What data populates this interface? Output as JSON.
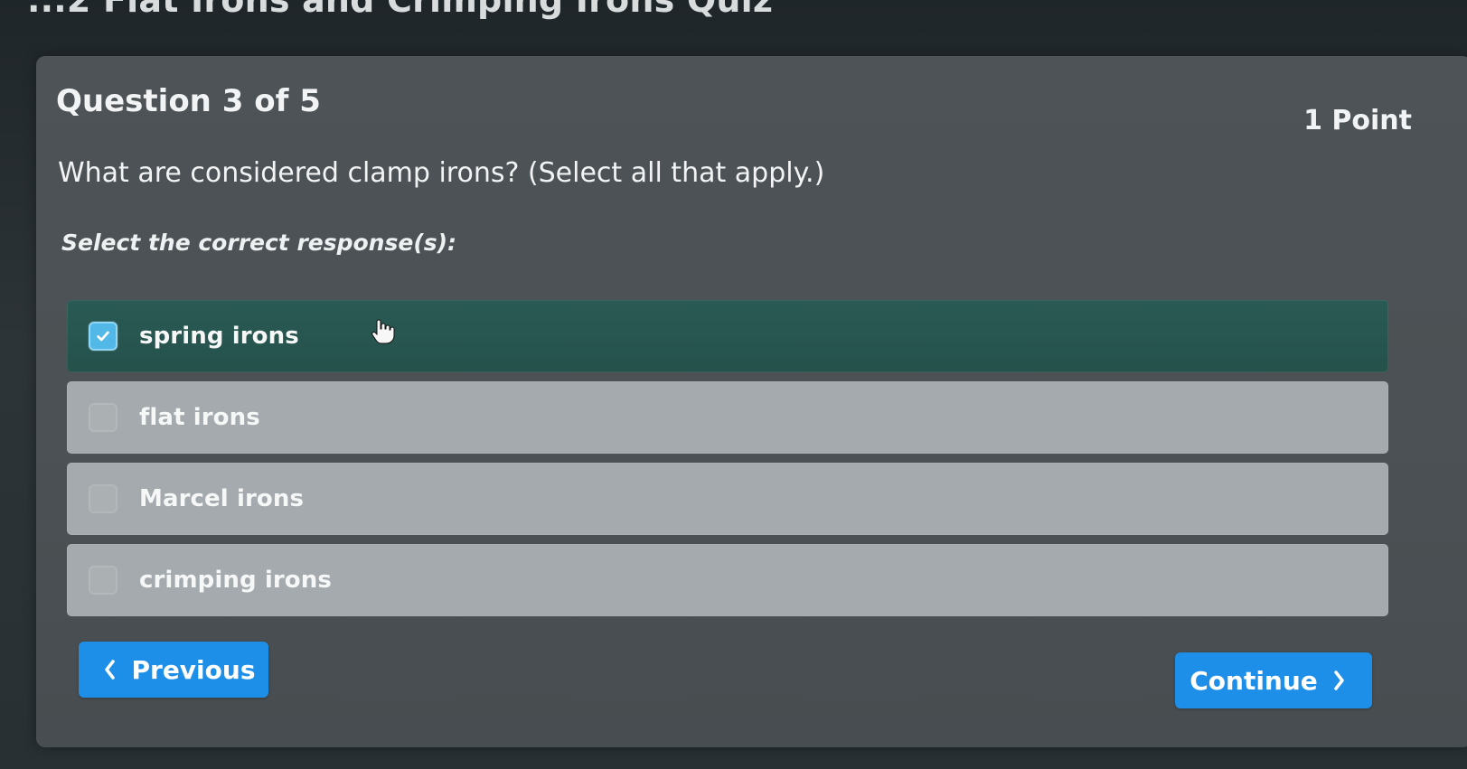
{
  "quiz": {
    "title": "...2 Flat Irons and Crimping Irons Quiz"
  },
  "question": {
    "number_text": "Question 3 of 5",
    "points_text": "1 Point",
    "prompt": "What are considered clamp irons? (Select all that apply.)",
    "instruction": "Select the correct response(s):"
  },
  "options": [
    {
      "label": "spring irons",
      "selected": true
    },
    {
      "label": "flat irons",
      "selected": false
    },
    {
      "label": "Marcel irons",
      "selected": false
    },
    {
      "label": "crimping irons",
      "selected": false
    }
  ],
  "navigation": {
    "previous_label": "Previous",
    "continue_label": "Continue"
  },
  "icons": {
    "checkbox_checked": "check-icon",
    "previous": "chevron-left-icon",
    "continue": "chevron-right-icon",
    "cursor": "hand-cursor-icon"
  },
  "colors": {
    "accent": "#1e8fe8",
    "selected_option": "#25514b",
    "unselected_option": "#a4aaad"
  }
}
